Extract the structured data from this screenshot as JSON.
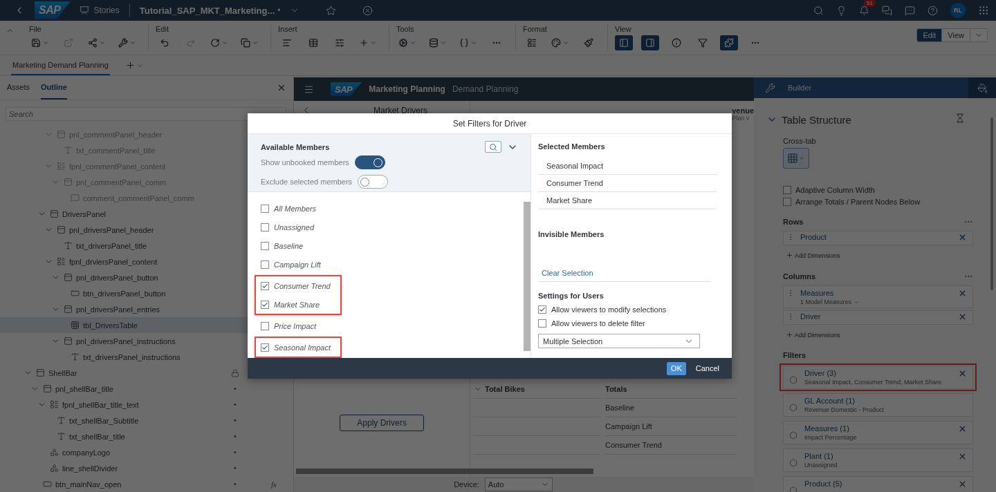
{
  "shell_bar": {
    "logo": "SAP",
    "section": "Stories",
    "story_title": "Tutorial_SAP_MKT_Marketing...",
    "title_marker": "•",
    "notification_count": "51",
    "avatar": "RL"
  },
  "toolbar": {
    "groups": [
      {
        "label": "File",
        "tools": [
          {
            "caret": true,
            "disabled": false,
            "pressed": false
          },
          {
            "caret": false,
            "disabled": true,
            "pressed": false
          },
          {
            "caret": true,
            "disabled": false,
            "pressed": false
          },
          {
            "caret": true,
            "disabled": false,
            "pressed": false
          }
        ]
      },
      {
        "label": "Edit",
        "tools": [
          {
            "caret": false,
            "disabled": false,
            "pressed": false
          },
          {
            "caret": false,
            "disabled": true,
            "pressed": false
          },
          {
            "caret": true,
            "disabled": false,
            "pressed": false
          },
          {
            "caret": true,
            "disabled": false,
            "pressed": false
          }
        ]
      },
      {
        "label": "Insert",
        "tools": [
          {
            "caret": false,
            "disabled": false,
            "pressed": false
          },
          {
            "caret": false,
            "disabled": false,
            "pressed": false
          },
          {
            "caret": false,
            "disabled": false,
            "pressed": false
          },
          {
            "caret": true,
            "disabled": false,
            "pressed": false
          }
        ]
      },
      {
        "label": "Tools",
        "tools": [
          {
            "caret": true,
            "disabled": false,
            "pressed": false
          },
          {
            "caret": true,
            "disabled": false,
            "pressed": false
          },
          {
            "caret": true,
            "disabled": false,
            "pressed": false
          },
          {
            "caret": false,
            "disabled": false,
            "pressed": false
          }
        ]
      },
      {
        "label": "Format",
        "tools": [
          {
            "caret": false,
            "disabled": false,
            "pressed": false
          },
          {
            "caret": true,
            "disabled": false,
            "pressed": false
          },
          {
            "caret": false,
            "disabled": false,
            "pressed": false
          }
        ]
      },
      {
        "label": "View",
        "tools": [
          {
            "caret": false,
            "disabled": false,
            "pressed": true
          },
          {
            "caret": false,
            "disabled": false,
            "pressed": true
          },
          {
            "caret": false,
            "disabled": false,
            "pressed": false
          },
          {
            "caret": false,
            "disabled": false,
            "pressed": false
          },
          {
            "caret": false,
            "disabled": false,
            "pressed": true
          },
          {
            "caret": false,
            "disabled": false,
            "pressed": false
          }
        ]
      }
    ],
    "modes": [
      {
        "label": "Edit",
        "selected": true
      },
      {
        "label": "View",
        "selected": false
      }
    ]
  },
  "page_tabs": [
    {
      "label": "Marketing Demand Planning",
      "selected": true
    }
  ],
  "outline": {
    "tabs": [
      {
        "label": "Assets",
        "selected": false
      },
      {
        "label": "Outline",
        "selected": true
      }
    ],
    "search": {
      "placeholder": "Search"
    },
    "tree": [
      {
        "children": [
          {
            "children": [
              {
                "children": [
                  {
                    "label": "pnl_commentPanel_header",
                    "kind": "panel",
                    "expanded": true,
                    "selected": false,
                    "dimmed": true,
                    "children": [
                      {
                        "label": "txt_commentPanel_title",
                        "kind": "text",
                        "selected": false,
                        "dimmed": true
                      }
                    ]
                  },
                  {
                    "label": "fpnl_commentPanel_content",
                    "kind": "flow-panel",
                    "expanded": true,
                    "selected": false,
                    "dimmed": true,
                    "children": [
                      {
                        "label": "pnl_commentPanel_comm",
                        "kind": "panel",
                        "expanded": true,
                        "selected": false,
                        "dimmed": true,
                        "children": [
                          {
                            "label": "comment_commentPanel_comm",
                            "kind": "comment",
                            "selected": false,
                            "dimmed": true
                          }
                        ]
                      }
                    ]
                  }
                ]
              },
              {
                "label": "DriversPanel",
                "kind": "panel",
                "expanded": true,
                "selected": false,
                "dimmed": false,
                "children": [
                  {
                    "label": "pnl_driversPanel_header",
                    "kind": "panel",
                    "expanded": true,
                    "selected": false,
                    "dimmed": false,
                    "children": [
                      {
                        "label": "txt_driversPanel_title",
                        "kind": "text",
                        "selected": false,
                        "dimmed": false
                      }
                    ]
                  },
                  {
                    "label": "fpnl_drviersPanel_content",
                    "kind": "flow-panel",
                    "expanded": true,
                    "selected": false,
                    "dimmed": false,
                    "children": [
                      {
                        "label": "pnl_driversPanel_button",
                        "kind": "panel",
                        "expanded": true,
                        "selected": false,
                        "dimmed": false,
                        "children": [
                          {
                            "label": "btn_driversPanel_button",
                            "kind": "button",
                            "selected": false,
                            "dimmed": false
                          }
                        ]
                      },
                      {
                        "label": "pnl_driversPanel_entries",
                        "kind": "panel",
                        "expanded": true,
                        "selected": false,
                        "dimmed": false,
                        "children": [
                          {
                            "label": "tbl_DriversTable",
                            "kind": "table",
                            "selected": true,
                            "dimmed": false
                          }
                        ]
                      },
                      {
                        "label": "pnl_driversPanel_instructions",
                        "kind": "panel",
                        "expanded": true,
                        "selected": false,
                        "dimmed": false,
                        "children": [
                          {
                            "label": "txt_driversPanel_instructions",
                            "kind": "text",
                            "selected": false,
                            "dimmed": false
                          }
                        ]
                      }
                    ]
                  }
                ]
              }
            ]
          }
        ]
      },
      {
        "label": "ShellBar",
        "kind": "panel",
        "expanded": true,
        "selected": false,
        "dimmed": false,
        "locked": true,
        "children": [
          {
            "label": "pnl_shellBar_title",
            "kind": "panel",
            "expanded": true,
            "selected": false,
            "dimmed": false,
            "marker": "•",
            "children": [
              {
                "label": "fpnl_shellBar_title_text",
                "kind": "flow-panel",
                "expanded": true,
                "selected": false,
                "dimmed": false,
                "marker": "•",
                "children": [
                  {
                    "label": "txt_shellBar_Subtitle",
                    "kind": "text",
                    "selected": false,
                    "dimmed": false,
                    "marker": "•"
                  },
                  {
                    "label": "txt_shellBar_title",
                    "kind": "text",
                    "selected": false,
                    "dimmed": false,
                    "marker": "•"
                  }
                ]
              },
              {
                "label": "companyLogo",
                "kind": "shape",
                "selected": false,
                "dimmed": false,
                "marker": "•"
              },
              {
                "label": "line_shellDivider",
                "kind": "shape",
                "selected": false,
                "dimmed": false,
                "marker": "•"
              }
            ]
          },
          {
            "label": "btn_mainNav_open",
            "kind": "button",
            "selected": false,
            "dimmed": false,
            "marker": "•",
            "badge": "fx"
          }
        ]
      }
    ]
  },
  "canvas": {
    "header": {
      "logo": "SAP",
      "title": "Marketing Planning",
      "subtitle": "Demand Planning"
    },
    "side_panel": {
      "title": "Market Drivers",
      "button": "Apply Drivers"
    },
    "chart_title": "venue",
    "chart_subtitle": "Plan v",
    "table": {
      "columns": [
        "Total Bikes",
        "Totals"
      ],
      "rows": [
        "Baseline",
        "Campaign Lift",
        "Consumer Trend"
      ]
    },
    "device": {
      "label": "Device:",
      "value": "Auto"
    }
  },
  "modal": {
    "title": "Set Filters for Driver",
    "available_heading": "Available Members",
    "toggles": [
      {
        "label": "Show unbooked members",
        "on": true
      },
      {
        "label": "Exclude selected members",
        "on": false
      }
    ],
    "member_groups": [
      {
        "highlighted": false,
        "members": [
          {
            "label": "All Members",
            "checked": false
          },
          {
            "label": "Unassigned",
            "checked": false
          },
          {
            "label": "Baseline",
            "checked": false
          },
          {
            "label": "Campaign Lift",
            "checked": false
          }
        ]
      },
      {
        "highlighted": true,
        "members": [
          {
            "label": "Consumer Trend",
            "checked": true
          },
          {
            "label": "Market Share",
            "checked": true
          }
        ]
      },
      {
        "highlighted": false,
        "members": [
          {
            "label": "Price Impact",
            "checked": false
          }
        ]
      },
      {
        "highlighted": true,
        "members": [
          {
            "label": "Seasonal Impact",
            "checked": true
          }
        ]
      }
    ],
    "selected_heading": "Selected Members",
    "selected_members": [
      "Seasonal Impact",
      "Consumer Trend",
      "Market Share"
    ],
    "invisible_heading": "Invisible Members",
    "clear_link": "Clear Selection",
    "settings_heading": "Settings for Users",
    "settings": [
      {
        "label": "Allow viewers to modify selections",
        "checked": true
      },
      {
        "label": "Allow viewers to delete filter",
        "checked": false
      }
    ],
    "selection_mode": "Multiple Selection",
    "buttons": [
      {
        "label": "OK",
        "kind": "primary"
      },
      {
        "label": "Cancel",
        "kind": "plain"
      }
    ]
  },
  "builder": {
    "title": "Builder",
    "section": {
      "title": "Table Structure",
      "expanded": true
    },
    "crosstab_label": "Cross-tab",
    "options": [
      {
        "label": "Adaptive Column Width",
        "checked": false
      },
      {
        "label": "Arrange Totals / Parent Nodes Below",
        "checked": false
      }
    ],
    "rows": {
      "title": "Rows",
      "items": [
        {
          "label": "Product"
        }
      ],
      "add": "Add Dimensions"
    },
    "columns": {
      "title": "Columns",
      "items": [
        {
          "label": "Measures",
          "detail": "1 Model Measures"
        },
        {
          "label": "Driver"
        }
      ],
      "add": "Add Dimensions"
    },
    "filters": {
      "title": "Filters",
      "items": [
        {
          "label": "Driver (3)",
          "detail": "Seasonal Impact, Consumer Trend, Market Share",
          "removable": true,
          "highlighted": true
        },
        {
          "label": "GL Account (1)",
          "detail": "Revenue Domestic - Product",
          "removable": false,
          "highlighted": false
        },
        {
          "label": "Measures (1)",
          "detail": "Impact Percentage",
          "removable": true,
          "highlighted": false
        },
        {
          "label": "Plant (1)",
          "detail": "Unassigned",
          "removable": true,
          "highlighted": false
        },
        {
          "label": "Product (5)",
          "removable": true,
          "highlighted": false
        }
      ]
    }
  }
}
